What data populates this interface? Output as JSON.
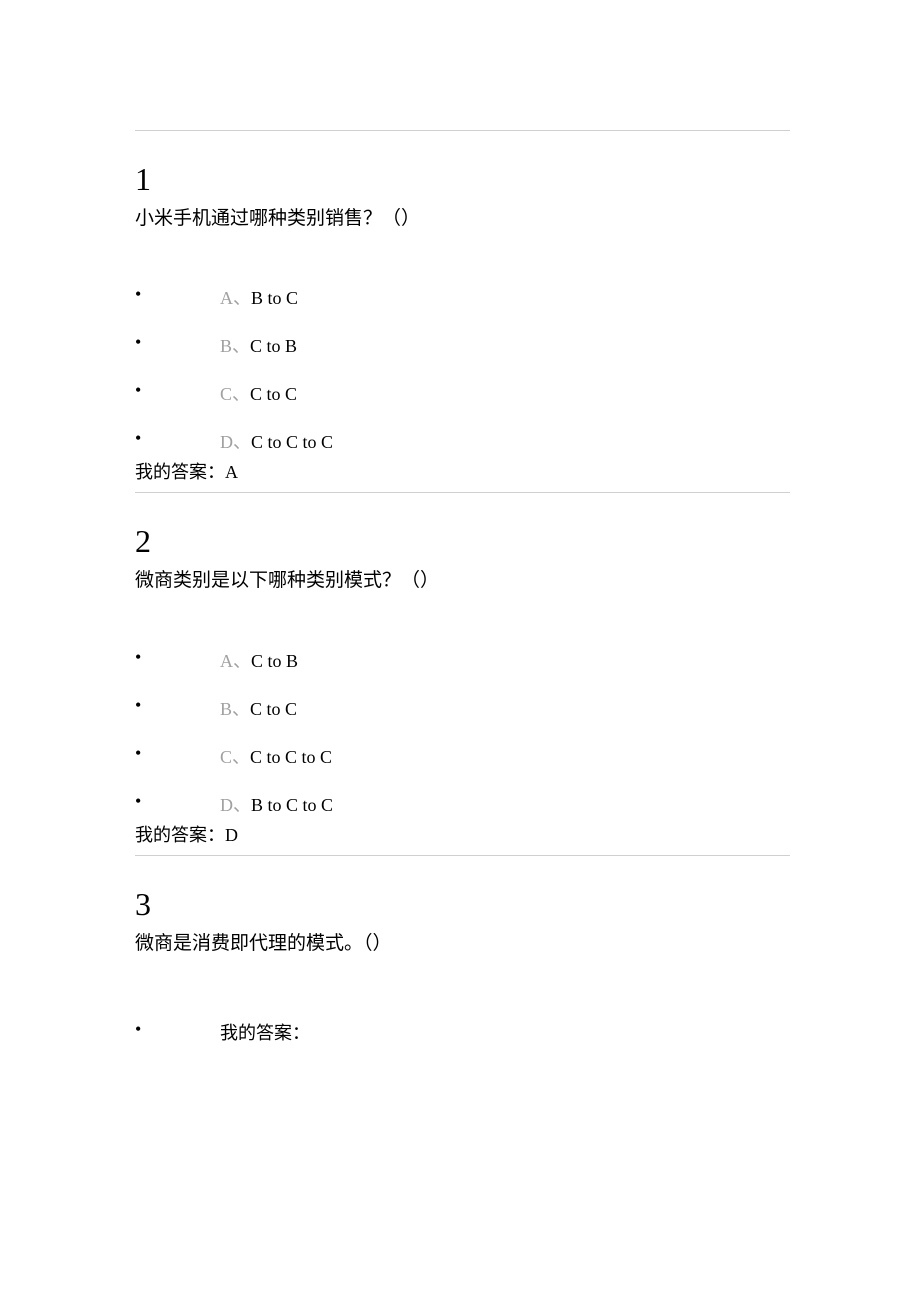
{
  "questions": [
    {
      "number": "1",
      "stem": "小米手机通过哪种类别销售？（）",
      "options": [
        {
          "letter": "A",
          "sep": "、",
          "text": "B to C"
        },
        {
          "letter": "B",
          "sep": "、",
          "text": "C to B"
        },
        {
          "letter": "C",
          "sep": "、",
          "text": "C to C"
        },
        {
          "letter": "D",
          "sep": "、",
          "text": "C to C to C"
        }
      ],
      "answer_label": "我的答案：",
      "answer_value": "A"
    },
    {
      "number": "2",
      "stem": "微商类别是以下哪种类别模式？（）",
      "options": [
        {
          "letter": "A",
          "sep": "、",
          "text": "C to B"
        },
        {
          "letter": "B",
          "sep": "、",
          "text": "C to C"
        },
        {
          "letter": "C",
          "sep": "、",
          "text": "C to C to C"
        },
        {
          "letter": "D",
          "sep": "、",
          "text": "B to C to C"
        }
      ],
      "answer_label": "我的答案：",
      "answer_value": "D"
    },
    {
      "number": "3",
      "stem": "微商是消费即代理的模式。（）",
      "options": [],
      "answer_label": "我的答案：",
      "answer_value": ""
    }
  ]
}
